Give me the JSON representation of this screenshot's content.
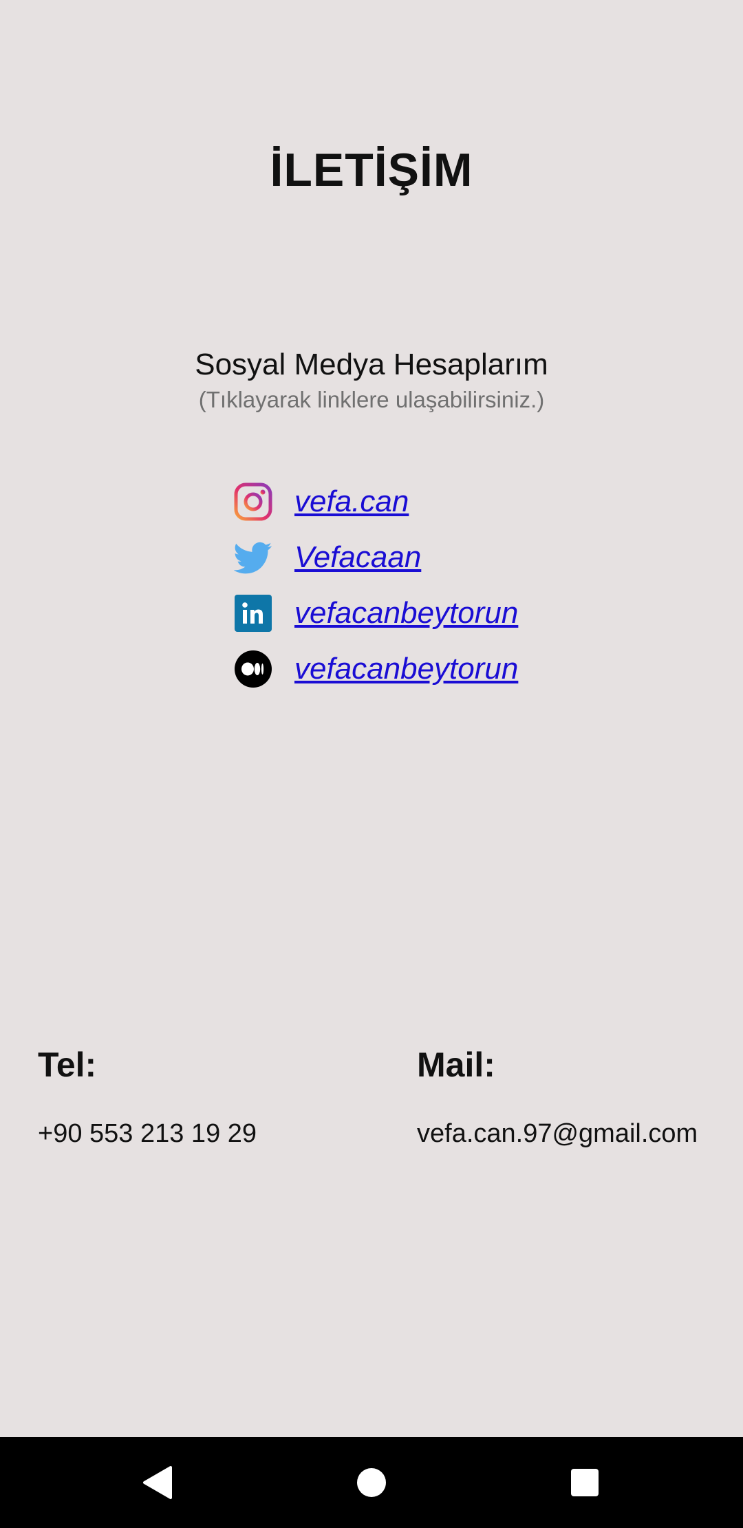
{
  "page": {
    "title": "İLETİŞİM"
  },
  "social": {
    "heading": "Sosyal Medya Hesaplarım",
    "hint": "(Tıklayarak linklere ulaşabilirsiniz.)",
    "items": [
      {
        "icon": "instagram-icon",
        "label": "vefa.can"
      },
      {
        "icon": "twitter-icon",
        "label": "Vefacaan"
      },
      {
        "icon": "linkedin-icon",
        "label": "vefacanbeytorun"
      },
      {
        "icon": "medium-icon",
        "label": "vefacanbeytorun"
      }
    ]
  },
  "contact": {
    "tel_label": "Tel:",
    "tel_value": "+90 553 213 19 29",
    "mail_label": "Mail:",
    "mail_value": "vefa.can.97@gmail.com"
  },
  "colors": {
    "background": "#e6e1e1",
    "link": "#1a0dd4",
    "hint": "#707070",
    "twitter": "#55acee",
    "linkedin": "#0e76a8"
  }
}
